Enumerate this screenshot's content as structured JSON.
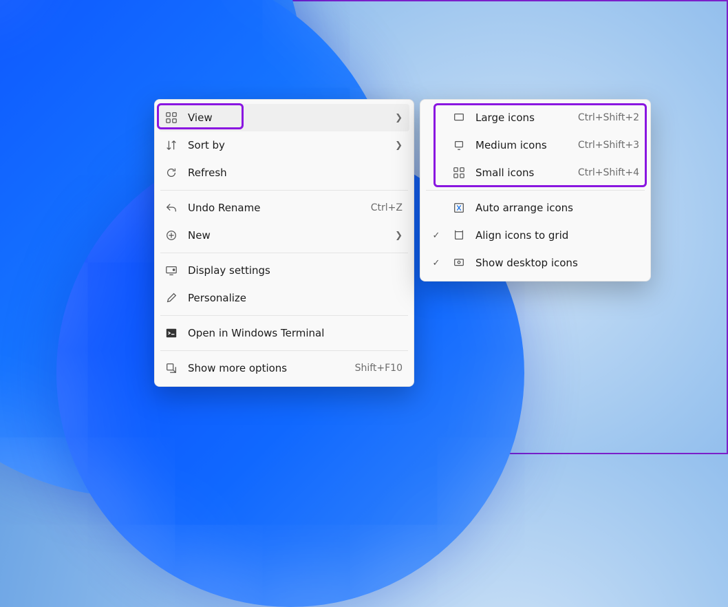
{
  "contextMenu": {
    "view": {
      "label": "View"
    },
    "sortBy": {
      "label": "Sort by"
    },
    "refresh": {
      "label": "Refresh"
    },
    "undo": {
      "label": "Undo Rename",
      "accel": "Ctrl+Z"
    },
    "new": {
      "label": "New"
    },
    "display": {
      "label": "Display settings"
    },
    "personal": {
      "label": "Personalize"
    },
    "terminal": {
      "label": "Open in Windows Terminal"
    },
    "more": {
      "label": "Show more options",
      "accel": "Shift+F10"
    }
  },
  "viewSubmenu": {
    "large": {
      "label": "Large icons",
      "accel": "Ctrl+Shift+2"
    },
    "medium": {
      "label": "Medium icons",
      "accel": "Ctrl+Shift+3"
    },
    "small": {
      "label": "Small icons",
      "accel": "Ctrl+Shift+4"
    },
    "auto": {
      "label": "Auto arrange icons"
    },
    "align": {
      "label": "Align icons to grid",
      "checked": true
    },
    "show": {
      "label": "Show desktop icons",
      "checked": true
    }
  }
}
